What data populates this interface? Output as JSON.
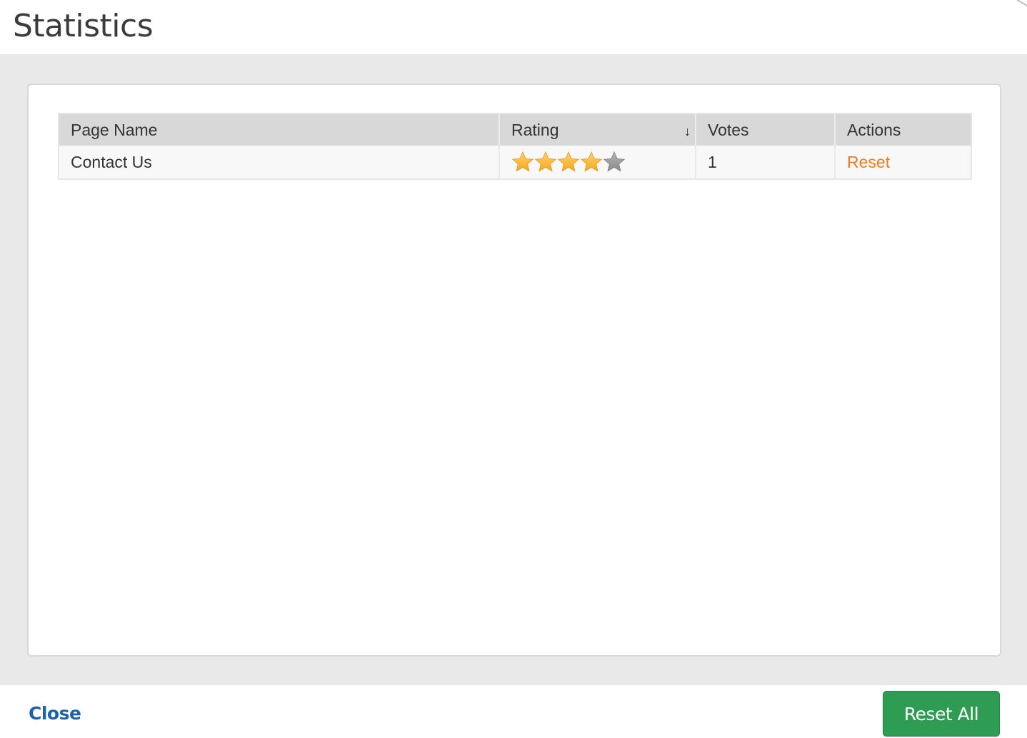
{
  "header": {
    "title": "Statistics"
  },
  "table": {
    "columns": [
      {
        "label": "Page Name"
      },
      {
        "label": "Rating",
        "sort": "descending",
        "sort_icon": "arrow-down-icon"
      },
      {
        "label": "Votes"
      },
      {
        "label": "Actions"
      }
    ],
    "rows": [
      {
        "page_name": "Contact Us",
        "rating": 4,
        "rating_max": 5,
        "votes": "1",
        "action_label": "Reset"
      }
    ]
  },
  "footer": {
    "close_label": "Close",
    "reset_all_label": "Reset All"
  },
  "colors": {
    "accent_link": "#f47a20",
    "close_link": "#1d63a8",
    "primary_button": "#2e9c53",
    "star_filled": "#f5a623",
    "star_empty": "#8a8a8a"
  }
}
